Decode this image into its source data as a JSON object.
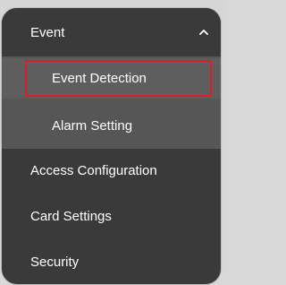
{
  "menu": {
    "event": {
      "label": "Event",
      "expanded": true,
      "icon": "chevron-up-icon",
      "children": [
        {
          "label": "Event Detection",
          "selected": true
        },
        {
          "label": "Alarm Setting",
          "selected": false
        }
      ]
    },
    "items": [
      {
        "label": "Access Configuration"
      },
      {
        "label": "Card Settings"
      },
      {
        "label": "Security"
      }
    ]
  },
  "colors": {
    "panel": "#3a3a3a",
    "submenu": "#565656",
    "selection_outline": "#d3222a",
    "text": "#ffffff"
  }
}
